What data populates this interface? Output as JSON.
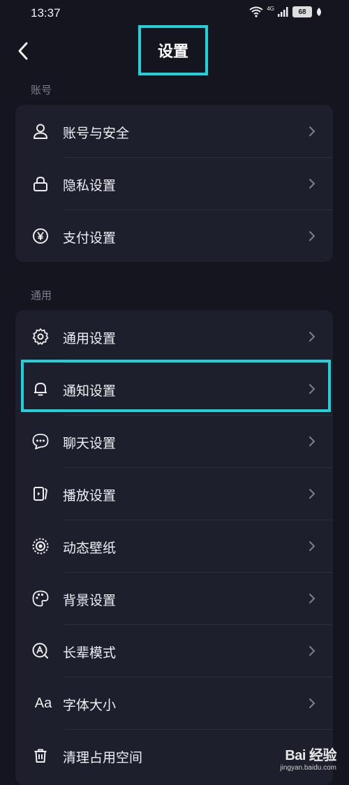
{
  "status": {
    "time": "13:37",
    "network": "4G",
    "battery": "68"
  },
  "header": {
    "title": "设置"
  },
  "sections": [
    {
      "label": "账号",
      "items": [
        {
          "label": "账号与安全",
          "icon": "user-icon"
        },
        {
          "label": "隐私设置",
          "icon": "lock-icon"
        },
        {
          "label": "支付设置",
          "icon": "yen-icon"
        }
      ]
    },
    {
      "label": "通用",
      "items": [
        {
          "label": "通用设置",
          "icon": "gear-icon"
        },
        {
          "label": "通知设置",
          "icon": "bell-icon"
        },
        {
          "label": "聊天设置",
          "icon": "chat-icon"
        },
        {
          "label": "播放设置",
          "icon": "play-icon"
        },
        {
          "label": "动态壁纸",
          "icon": "wallpaper-icon"
        },
        {
          "label": "背景设置",
          "icon": "palette-icon"
        },
        {
          "label": "长辈模式",
          "icon": "elder-mode-icon"
        },
        {
          "label": "字体大小",
          "icon": "font-size-icon"
        },
        {
          "label": "清理占用空间",
          "icon": "trash-icon"
        }
      ]
    }
  ],
  "watermark": {
    "brand": "Bai 经验",
    "site": "jingyan.baidu.com"
  },
  "colors": {
    "background": "#14151f",
    "card": "#1d1f2c",
    "highlight": "#1fd1d8"
  }
}
